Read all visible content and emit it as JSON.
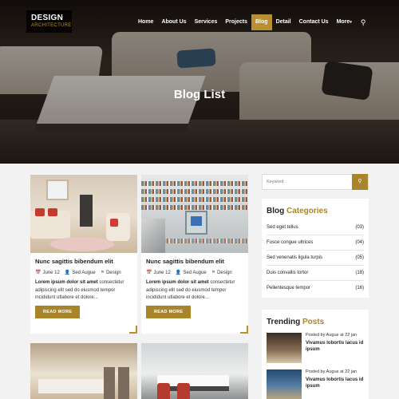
{
  "logo": {
    "line1": "DESIGN",
    "line2": "ARCHITECTURE"
  },
  "nav": {
    "items": [
      "Home",
      "About Us",
      "Services",
      "Projects",
      "Blog",
      "Detail",
      "Contact Us",
      "More"
    ],
    "active": "Blog",
    "more_caret": "▾"
  },
  "hero": {
    "title": "Blog List"
  },
  "posts": [
    {
      "title": "Nunc sagittis bibendum elit",
      "date": "June 12",
      "author": "Sed Augue",
      "tag": "Design",
      "excerpt_bold": "Lorem ipsum dolor sit amet",
      "excerpt": "consectetur adipiscing elit sed do eiusmod tempor incididunt utlabore et dolore...",
      "read_more": "READ MORE"
    },
    {
      "title": "Nunc sagittis bibendum elit",
      "date": "June 12",
      "author": "Sed Augue",
      "tag": "Design",
      "excerpt_bold": "Lorem ipsum dolor sit amet",
      "excerpt": "consectetur adipiscing elit sed do eiusmod tempor incididunt utlabore et dolore...",
      "read_more": "READ MORE"
    }
  ],
  "sidebar": {
    "search": {
      "placeholder": "Keyword"
    },
    "categories": {
      "title_plain": "Blog",
      "title_accent": "Categories",
      "items": [
        {
          "label": "Sed eget tellus",
          "count": "(03)"
        },
        {
          "label": "Fusce congue ultrices",
          "count": "(04)"
        },
        {
          "label": "Sed venenatis ligula turpis",
          "count": "(05)"
        },
        {
          "label": "Duis convallis tortor",
          "count": "(18)"
        },
        {
          "label": "Pellentesque tempor",
          "count": "(16)"
        }
      ]
    },
    "trending": {
      "title_plain": "Trending",
      "title_accent": "Posts",
      "items": [
        {
          "meta": "Posted by Augue at 22 jan",
          "title": "Vivamus lobortis lacus id ipsum"
        },
        {
          "meta": "Posted by Augue at 22 jan",
          "title": "Vivamus lobortis lacus id ipsum"
        }
      ]
    }
  },
  "colors": {
    "accent": "#a8852a",
    "active_nav": "#b8902f"
  },
  "icons": {
    "search": "search-icon",
    "calendar": "calendar-icon",
    "user": "user-icon",
    "tag": "tag-icon"
  }
}
